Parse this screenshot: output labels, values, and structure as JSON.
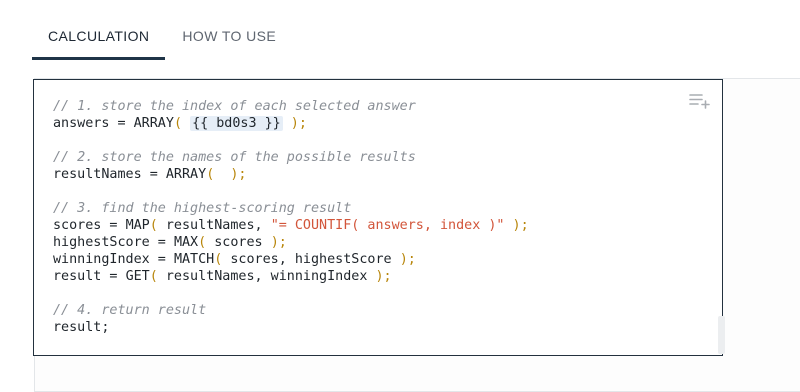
{
  "tabs": [
    {
      "label": "CALCULATION",
      "active": true
    },
    {
      "label": "HOW TO USE",
      "active": false
    }
  ],
  "code": {
    "c1": "// 1. store the index of each selected answer",
    "l1_var": "answers = ",
    "l1_fn": "ARRAY",
    "l1_open": "( ",
    "l1_tag": "{{ bd0s3 }}",
    "l1_close": " );",
    "c2": "// 2. store the names of the possible results",
    "l2_var": "resultNames = ",
    "l2_fn": "ARRAY",
    "l2_open": "(  ",
    "l2_close": ");",
    "c3": "// 3. find the highest-scoring result",
    "l3_var": "scores = ",
    "l3_fn": "MAP",
    "l3_open": "( ",
    "l3_args": "resultNames, ",
    "l3_str": "\"= COUNTIF( answers, index )\"",
    "l3_close": " );",
    "l4_var": "highestScore = ",
    "l4_fn": "MAX",
    "l4_open": "( ",
    "l4_args": "scores ",
    "l4_close": ");",
    "l5_var": "winningIndex = ",
    "l5_fn": "MATCH",
    "l5_open": "( ",
    "l5_args": "scores, highestScore ",
    "l5_close": ");",
    "l6_var": "result = ",
    "l6_fn": "GET",
    "l6_open": "( ",
    "l6_args": "resultNames, winningIndex ",
    "l6_close": ");",
    "c4": "// 4. return result",
    "l7": "result;"
  },
  "icons": {
    "menu": "playlist-add-icon"
  }
}
